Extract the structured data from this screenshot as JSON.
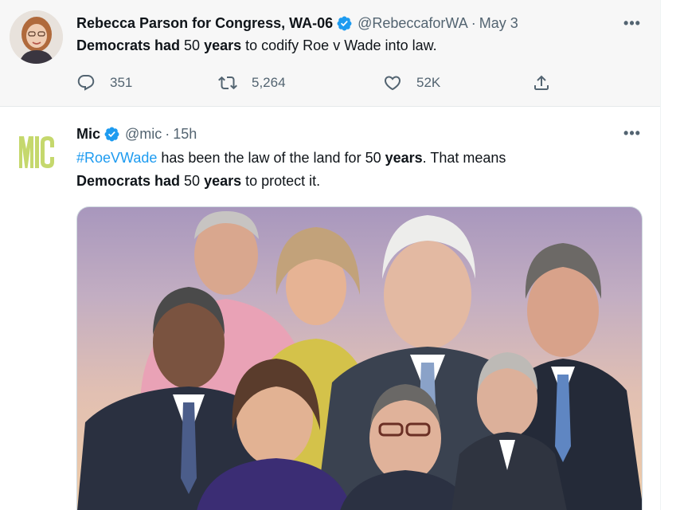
{
  "tweets": [
    {
      "author_name": "Rebecca Parson for Congress, WA-06",
      "handle": "@RebeccaforWA",
      "separator": "·",
      "time": "May 3",
      "more": "•••",
      "text": {
        "b1": "Democrats had",
        "t1": " 50 ",
        "b2": "years",
        "t2": " to codify Roe v Wade into law."
      },
      "actions": {
        "reply": "351",
        "retweet": "5,264",
        "like": "52K"
      }
    },
    {
      "author_name": "Mic",
      "handle": "@mic",
      "separator": "·",
      "time": "15h",
      "more": "•••",
      "logo_text": "MIC",
      "text": {
        "hashtag": "#RoeVWade",
        "t1": " has been the law of the land for 50 ",
        "b1": "years",
        "t2": ". That means",
        "b2": "Democrats had",
        "t3": " 50 ",
        "b3": "years",
        "t4": " to protect it."
      }
    }
  ],
  "colors": {
    "verified_blue": "#1d9bf0",
    "hashtag_blue": "#1d9bf0",
    "secondary_text": "#536471",
    "mic_logo": "#c5d86d"
  },
  "icons": [
    "verified-icon",
    "reply-icon",
    "retweet-icon",
    "like-icon",
    "share-icon",
    "more-icon"
  ]
}
